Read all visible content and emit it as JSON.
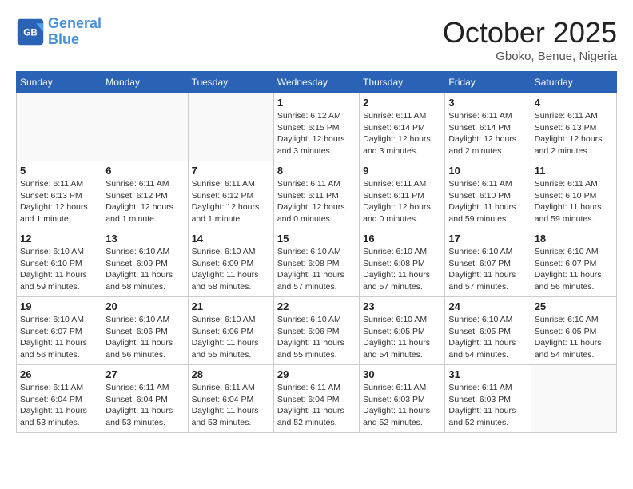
{
  "header": {
    "logo_line1": "General",
    "logo_line2": "Blue",
    "month": "October 2025",
    "location": "Gboko, Benue, Nigeria"
  },
  "weekdays": [
    "Sunday",
    "Monday",
    "Tuesday",
    "Wednesday",
    "Thursday",
    "Friday",
    "Saturday"
  ],
  "weeks": [
    [
      {
        "day": "",
        "info": ""
      },
      {
        "day": "",
        "info": ""
      },
      {
        "day": "",
        "info": ""
      },
      {
        "day": "1",
        "info": "Sunrise: 6:12 AM\nSunset: 6:15 PM\nDaylight: 12 hours and 3 minutes."
      },
      {
        "day": "2",
        "info": "Sunrise: 6:11 AM\nSunset: 6:14 PM\nDaylight: 12 hours and 3 minutes."
      },
      {
        "day": "3",
        "info": "Sunrise: 6:11 AM\nSunset: 6:14 PM\nDaylight: 12 hours and 2 minutes."
      },
      {
        "day": "4",
        "info": "Sunrise: 6:11 AM\nSunset: 6:13 PM\nDaylight: 12 hours and 2 minutes."
      }
    ],
    [
      {
        "day": "5",
        "info": "Sunrise: 6:11 AM\nSunset: 6:13 PM\nDaylight: 12 hours and 1 minute."
      },
      {
        "day": "6",
        "info": "Sunrise: 6:11 AM\nSunset: 6:12 PM\nDaylight: 12 hours and 1 minute."
      },
      {
        "day": "7",
        "info": "Sunrise: 6:11 AM\nSunset: 6:12 PM\nDaylight: 12 hours and 1 minute."
      },
      {
        "day": "8",
        "info": "Sunrise: 6:11 AM\nSunset: 6:11 PM\nDaylight: 12 hours and 0 minutes."
      },
      {
        "day": "9",
        "info": "Sunrise: 6:11 AM\nSunset: 6:11 PM\nDaylight: 12 hours and 0 minutes."
      },
      {
        "day": "10",
        "info": "Sunrise: 6:11 AM\nSunset: 6:10 PM\nDaylight: 11 hours and 59 minutes."
      },
      {
        "day": "11",
        "info": "Sunrise: 6:11 AM\nSunset: 6:10 PM\nDaylight: 11 hours and 59 minutes."
      }
    ],
    [
      {
        "day": "12",
        "info": "Sunrise: 6:10 AM\nSunset: 6:10 PM\nDaylight: 11 hours and 59 minutes."
      },
      {
        "day": "13",
        "info": "Sunrise: 6:10 AM\nSunset: 6:09 PM\nDaylight: 11 hours and 58 minutes."
      },
      {
        "day": "14",
        "info": "Sunrise: 6:10 AM\nSunset: 6:09 PM\nDaylight: 11 hours and 58 minutes."
      },
      {
        "day": "15",
        "info": "Sunrise: 6:10 AM\nSunset: 6:08 PM\nDaylight: 11 hours and 57 minutes."
      },
      {
        "day": "16",
        "info": "Sunrise: 6:10 AM\nSunset: 6:08 PM\nDaylight: 11 hours and 57 minutes."
      },
      {
        "day": "17",
        "info": "Sunrise: 6:10 AM\nSunset: 6:07 PM\nDaylight: 11 hours and 57 minutes."
      },
      {
        "day": "18",
        "info": "Sunrise: 6:10 AM\nSunset: 6:07 PM\nDaylight: 11 hours and 56 minutes."
      }
    ],
    [
      {
        "day": "19",
        "info": "Sunrise: 6:10 AM\nSunset: 6:07 PM\nDaylight: 11 hours and 56 minutes."
      },
      {
        "day": "20",
        "info": "Sunrise: 6:10 AM\nSunset: 6:06 PM\nDaylight: 11 hours and 56 minutes."
      },
      {
        "day": "21",
        "info": "Sunrise: 6:10 AM\nSunset: 6:06 PM\nDaylight: 11 hours and 55 minutes."
      },
      {
        "day": "22",
        "info": "Sunrise: 6:10 AM\nSunset: 6:06 PM\nDaylight: 11 hours and 55 minutes."
      },
      {
        "day": "23",
        "info": "Sunrise: 6:10 AM\nSunset: 6:05 PM\nDaylight: 11 hours and 54 minutes."
      },
      {
        "day": "24",
        "info": "Sunrise: 6:10 AM\nSunset: 6:05 PM\nDaylight: 11 hours and 54 minutes."
      },
      {
        "day": "25",
        "info": "Sunrise: 6:10 AM\nSunset: 6:05 PM\nDaylight: 11 hours and 54 minutes."
      }
    ],
    [
      {
        "day": "26",
        "info": "Sunrise: 6:11 AM\nSunset: 6:04 PM\nDaylight: 11 hours and 53 minutes."
      },
      {
        "day": "27",
        "info": "Sunrise: 6:11 AM\nSunset: 6:04 PM\nDaylight: 11 hours and 53 minutes."
      },
      {
        "day": "28",
        "info": "Sunrise: 6:11 AM\nSunset: 6:04 PM\nDaylight: 11 hours and 53 minutes."
      },
      {
        "day": "29",
        "info": "Sunrise: 6:11 AM\nSunset: 6:04 PM\nDaylight: 11 hours and 52 minutes."
      },
      {
        "day": "30",
        "info": "Sunrise: 6:11 AM\nSunset: 6:03 PM\nDaylight: 11 hours and 52 minutes."
      },
      {
        "day": "31",
        "info": "Sunrise: 6:11 AM\nSunset: 6:03 PM\nDaylight: 11 hours and 52 minutes."
      },
      {
        "day": "",
        "info": ""
      }
    ]
  ]
}
